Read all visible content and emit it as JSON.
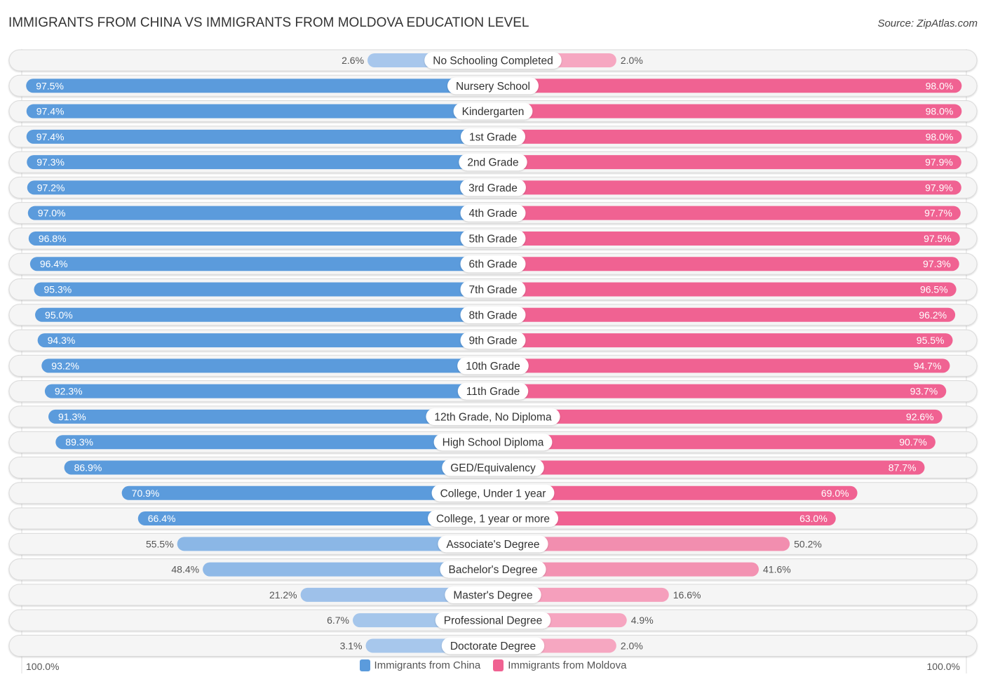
{
  "header": {
    "title": "IMMIGRANTS FROM CHINA VS IMMIGRANTS FROM MOLDOVA EDUCATION LEVEL",
    "source": "Source: ZipAtlas.com"
  },
  "axis": {
    "left_label": "100.0%",
    "right_label": "100.0%"
  },
  "legend": [
    {
      "label": "Immigrants from China",
      "color": "#5b9bdc"
    },
    {
      "label": "Immigrants from Moldova",
      "color": "#f06292"
    }
  ],
  "chart_data": {
    "type": "bar",
    "orientation": "horizontal-diverging",
    "title": "IMMIGRANTS FROM CHINA VS IMMIGRANTS FROM MOLDOVA EDUCATION LEVEL",
    "xlabel": "",
    "ylabel": "",
    "xlim": [
      0,
      100
    ],
    "legend_position": "bottom-center",
    "categories": [
      "No Schooling Completed",
      "Nursery School",
      "Kindergarten",
      "1st Grade",
      "2nd Grade",
      "3rd Grade",
      "4th Grade",
      "5th Grade",
      "6th Grade",
      "7th Grade",
      "8th Grade",
      "9th Grade",
      "10th Grade",
      "11th Grade",
      "12th Grade, No Diploma",
      "High School Diploma",
      "GED/Equivalency",
      "College, Under 1 year",
      "College, 1 year or more",
      "Associate's Degree",
      "Bachelor's Degree",
      "Master's Degree",
      "Professional Degree",
      "Doctorate Degree"
    ],
    "series": [
      {
        "name": "Immigrants from China",
        "color": "#5b9bdc",
        "side": "left",
        "values": [
          2.6,
          97.5,
          97.4,
          97.4,
          97.3,
          97.2,
          97.0,
          96.8,
          96.4,
          95.3,
          95.0,
          94.3,
          93.2,
          92.3,
          91.3,
          89.3,
          86.9,
          70.9,
          66.4,
          55.5,
          48.4,
          21.2,
          6.7,
          3.1
        ],
        "labels": [
          "2.6%",
          "97.5%",
          "97.4%",
          "97.4%",
          "97.3%",
          "97.2%",
          "97.0%",
          "96.8%",
          "96.4%",
          "95.3%",
          "95.0%",
          "94.3%",
          "93.2%",
          "92.3%",
          "91.3%",
          "89.3%",
          "86.9%",
          "70.9%",
          "66.4%",
          "55.5%",
          "48.4%",
          "21.2%",
          "6.7%",
          "3.1%"
        ]
      },
      {
        "name": "Immigrants from Moldova",
        "color": "#f06292",
        "side": "right",
        "values": [
          2.0,
          98.0,
          98.0,
          98.0,
          97.9,
          97.9,
          97.7,
          97.5,
          97.3,
          96.5,
          96.2,
          95.5,
          94.7,
          93.7,
          92.6,
          90.7,
          87.7,
          69.0,
          63.0,
          50.2,
          41.6,
          16.6,
          4.9,
          2.0
        ],
        "labels": [
          "2.0%",
          "98.0%",
          "98.0%",
          "98.0%",
          "97.9%",
          "97.9%",
          "97.7%",
          "97.5%",
          "97.3%",
          "96.5%",
          "96.2%",
          "95.5%",
          "94.7%",
          "93.7%",
          "92.6%",
          "90.7%",
          "87.7%",
          "69.0%",
          "63.0%",
          "50.2%",
          "41.6%",
          "16.6%",
          "4.9%",
          "2.0%"
        ]
      }
    ]
  }
}
